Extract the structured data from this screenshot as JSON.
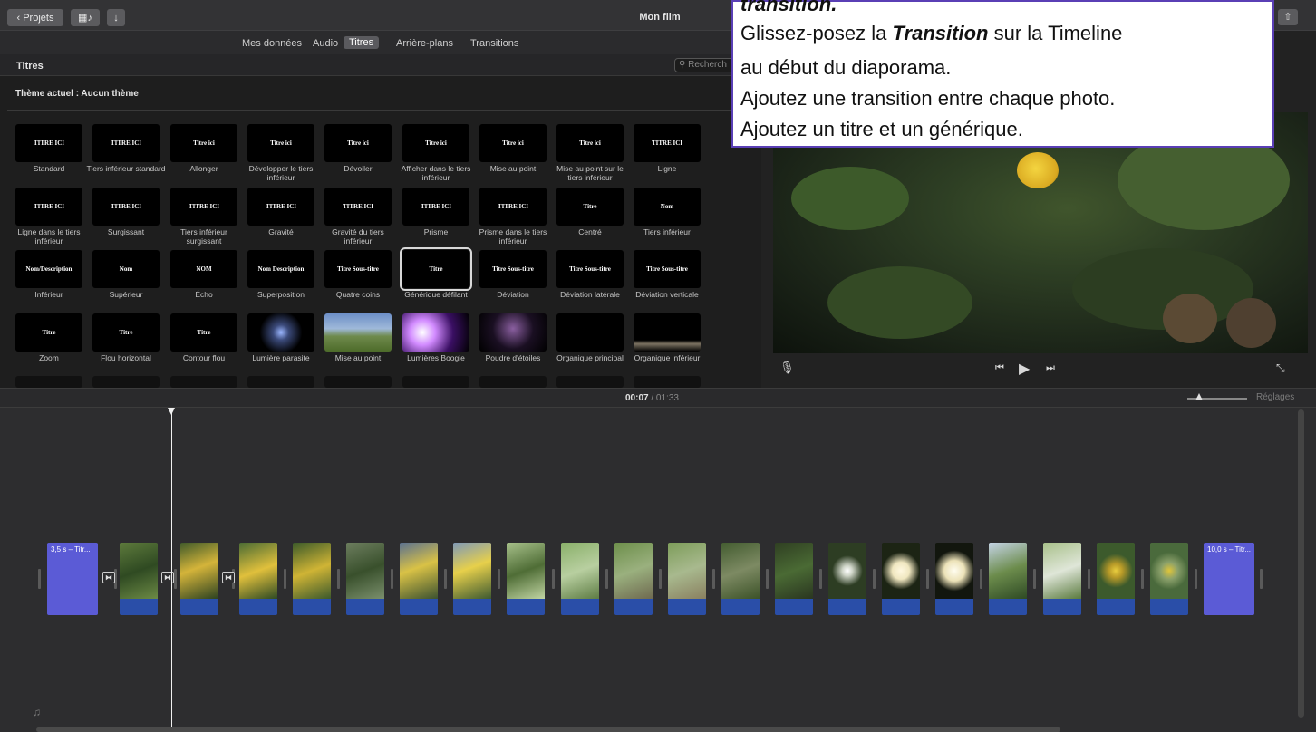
{
  "toolbar": {
    "back_label": "Projets",
    "window_title": "Mon film"
  },
  "tabs": [
    "Mes données",
    "Audio",
    "Titres",
    "Arrière-plans",
    "Transitions"
  ],
  "browser": {
    "title": "Titres",
    "search_placeholder": "Recherch",
    "theme_label": "Thème actuel : Aucun thème",
    "tiles": [
      {
        "name": "Standard",
        "preview": "TITRE ICI"
      },
      {
        "name": "Tiers inférieur standard",
        "preview": "TITRE ICI"
      },
      {
        "name": "Allonger",
        "preview": "Titre ici"
      },
      {
        "name": "Développer le tiers inférieur",
        "preview": "Titre ici"
      },
      {
        "name": "Dévoiler",
        "preview": "Titre ici"
      },
      {
        "name": "Afficher dans le tiers inférieur",
        "preview": "Titre ici"
      },
      {
        "name": "Mise au point",
        "preview": "Titre ici"
      },
      {
        "name": "Mise au point sur le tiers inférieur",
        "preview": "Titre ici"
      },
      {
        "name": "Ligne",
        "preview": "TITRE ICI"
      },
      {
        "name": "Ligne dans le tiers inférieur",
        "preview": "TITRE ICI"
      },
      {
        "name": "Surgissant",
        "preview": "TITRE ICI"
      },
      {
        "name": "Tiers inférieur surgissant",
        "preview": "TITRE ICI"
      },
      {
        "name": "Gravité",
        "preview": "TITRE ICI"
      },
      {
        "name": "Gravité du tiers inférieur",
        "preview": "TITRE ICI"
      },
      {
        "name": "Prisme",
        "preview": "TITRE ICI"
      },
      {
        "name": "Prisme dans le tiers inférieur",
        "preview": "TITRE ICI"
      },
      {
        "name": "Centré",
        "preview": "Titre"
      },
      {
        "name": "Tiers inférieur",
        "preview": "Nom"
      },
      {
        "name": "Inférieur",
        "preview": "Nom/Description"
      },
      {
        "name": "Supérieur",
        "preview": "Nom"
      },
      {
        "name": "Écho",
        "preview": "NOM"
      },
      {
        "name": "Superposition",
        "preview": "Nom Description"
      },
      {
        "name": "Quatre coins",
        "preview": "Titre Sous-titre"
      },
      {
        "name": "Générique défilant",
        "preview": "Titre"
      },
      {
        "name": "Déviation",
        "preview": "Titre Sous-titre"
      },
      {
        "name": "Déviation latérale",
        "preview": "Titre Sous-titre"
      },
      {
        "name": "Déviation verticale",
        "preview": "Titre Sous-titre"
      },
      {
        "name": "Zoom",
        "preview": "Titre"
      },
      {
        "name": "Flou horizontal",
        "preview": "Titre"
      },
      {
        "name": "Contour flou",
        "preview": "Titre"
      },
      {
        "name": "Lumière parasite",
        "preview": ""
      },
      {
        "name": "Mise au point",
        "preview": ""
      },
      {
        "name": "Lumières Boogie",
        "preview": ""
      },
      {
        "name": "Poudre d'étoiles",
        "preview": ""
      },
      {
        "name": "Organique principal",
        "preview": ""
      },
      {
        "name": "Organique inférieur",
        "preview": ""
      }
    ]
  },
  "timecode": {
    "current": "00:07",
    "total": "/ 01:33"
  },
  "settings_label": "Réglages",
  "timeline": {
    "start_title": "3,5 s – Titr...",
    "end_title": "10,0 s – Titr..."
  },
  "callout": {
    "line0": "transition.",
    "line1_a": "Glissez-posez la ",
    "line1_b": "Transition",
    "line1_c": " sur la Timeline",
    "line2": "au début du diaporama.",
    "line3": "Ajoutez une transition entre chaque photo.",
    "line4": "Ajoutez un titre et un générique."
  },
  "colors": {
    "accent_title_clip": "#5b5bd6",
    "audio_band": "#2a4ea8",
    "callout_border": "#5a3fb5"
  }
}
